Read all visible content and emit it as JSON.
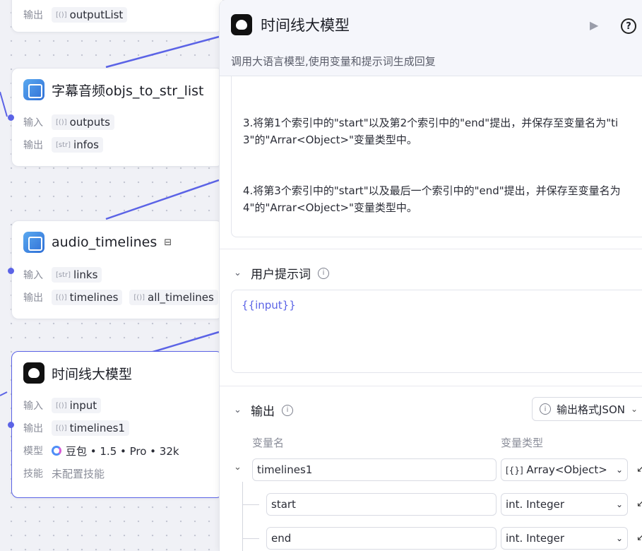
{
  "canvas": {
    "top_node": {
      "output_label": "输出",
      "output_value": "outputList"
    },
    "subtitle_node": {
      "title": "字幕音频objs_to_str_list",
      "input_label": "输入",
      "input_value": "outputs",
      "output_label": "输出",
      "output_value": "infos"
    },
    "audio_node": {
      "title": "audio_timelines",
      "input_label": "输入",
      "input_value": "links",
      "output_label": "输出",
      "output_values": [
        "timelines",
        "all_timelines"
      ]
    },
    "llm_node": {
      "title": "时间线大模型",
      "input_label": "输入",
      "input_value": "input",
      "output_label": "输出",
      "output_value": "timelines1",
      "model_label": "模型",
      "model_value": "豆包 • 1.5 • Pro • 32k",
      "skill_label": "技能",
      "skill_value": "未配置技能"
    },
    "accent_color": "#5b63e6"
  },
  "panel": {
    "title": "时间线大模型",
    "description": "调用大语言模型,使用变量和提示词生成回复",
    "system_prompt_lines": [
      [
        "3.将第1个索引中的\"start\"以及第2个索引中的\"end\"提出，并保存至变量名为\"ti",
        "3\"的\"Arrar<Object>\"变量类型中。"
      ],
      [
        "4.将第3个索引中的\"start\"以及最后一个索引中的\"end\"提出，并保存至变量名为",
        "4\"的\"Arrar<Object>\"变量类型中。"
      ]
    ],
    "user_prompt": {
      "label": "用户提示词",
      "value": "{{input}}"
    },
    "output": {
      "label": "输出",
      "format_button": "输出格式JSON",
      "col_name": "变量名",
      "col_type": "变量类型",
      "rows": [
        {
          "name": "timelines1",
          "type": "Array<Object>",
          "type_prefix": "[{}]"
        },
        {
          "name": "start",
          "type": "Integer",
          "type_prefix": "int."
        },
        {
          "name": "end",
          "type": "Integer",
          "type_prefix": "int."
        }
      ]
    }
  }
}
